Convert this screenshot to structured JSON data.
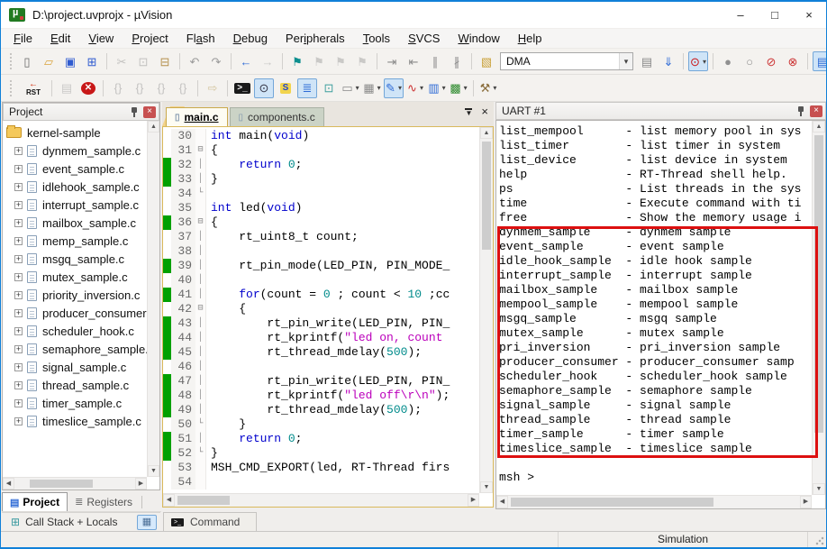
{
  "window": {
    "title": "D:\\project.uvprojx - µVision",
    "minimize": "–",
    "maximize": "□",
    "close": "×"
  },
  "icons": {
    "up": "▲",
    "down": "▼",
    "left": "◀",
    "right": "▶"
  },
  "menu": {
    "items": [
      {
        "label": "File",
        "accel": 0
      },
      {
        "label": "Edit",
        "accel": 0
      },
      {
        "label": "View",
        "accel": 0
      },
      {
        "label": "Project",
        "accel": 0
      },
      {
        "label": "Flash",
        "accel": 2
      },
      {
        "label": "Debug",
        "accel": 0
      },
      {
        "label": "Peripherals",
        "accel": 3
      },
      {
        "label": "Tools",
        "accel": 0
      },
      {
        "label": "SVCS",
        "accel": 0
      },
      {
        "label": "Window",
        "accel": 0
      },
      {
        "label": "Help",
        "accel": 0
      }
    ]
  },
  "toolbar_main": {
    "buttons": [
      {
        "name": "new-file-button",
        "g": "▯",
        "c": "#666"
      },
      {
        "name": "open-file-button",
        "g": "▱",
        "c": "#d9a43d"
      },
      {
        "name": "save-button",
        "g": "▣",
        "c": "#2f5bd0"
      },
      {
        "name": "save-all-button",
        "g": "⊞",
        "c": "#2f5bd0"
      },
      {
        "sep": true
      },
      {
        "name": "cut-button",
        "g": "✂",
        "c": "#999",
        "off": true
      },
      {
        "name": "copy-button",
        "g": "⊡",
        "c": "#999",
        "off": true
      },
      {
        "name": "paste-button",
        "g": "⊟",
        "c": "#b5914e"
      },
      {
        "sep": true
      },
      {
        "name": "undo-button",
        "g": "↶",
        "c": "#9a9a9a"
      },
      {
        "name": "redo-button",
        "g": "↷",
        "c": "#9a9a9a"
      },
      {
        "sep": true
      },
      {
        "name": "navigate-back-button",
        "g": "←",
        "c": "#2e6bd6"
      },
      {
        "name": "navigate-forward-button",
        "g": "→",
        "c": "#a8a8a8",
        "off": true
      },
      {
        "sep": true
      },
      {
        "name": "insert-bookmark-button",
        "g": "⚑",
        "c": "#0d8f8f"
      },
      {
        "name": "previous-bookmark-button",
        "g": "⚑",
        "c": "#a8a8a8",
        "off": true
      },
      {
        "name": "next-bookmark-button",
        "g": "⚑",
        "c": "#a8a8a8",
        "off": true
      },
      {
        "name": "clear-bookmarks-button",
        "g": "⚑",
        "c": "#a8a8a8",
        "off": true
      },
      {
        "sep": true
      },
      {
        "name": "indent-button",
        "g": "⇥",
        "c": "#8a8a8a"
      },
      {
        "name": "unindent-button",
        "g": "⇤",
        "c": "#8a8a8a"
      },
      {
        "name": "comment-button",
        "g": "∥",
        "c": "#8a8a8a"
      },
      {
        "name": "uncomment-button",
        "g": "∦",
        "c": "#8a8a8a"
      },
      {
        "sep": true
      },
      {
        "name": "options-for-target-button",
        "g": "▧",
        "c": "#caa23a"
      },
      {
        "name": "target-select",
        "combo": true,
        "value": "DMA"
      },
      {
        "name": "file-extensions-button",
        "g": "▤",
        "c": "#8a8a8a"
      },
      {
        "name": "find-in-files-button",
        "g": "⇓",
        "c": "#2e6bd6"
      },
      {
        "sep": true
      },
      {
        "name": "quick-search-dropdown",
        "g": "⊙",
        "c": "#cc1111",
        "dd": true,
        "on": true
      },
      {
        "sep": true
      },
      {
        "name": "insert-breakpoint-button",
        "g": "●",
        "c": "#909090"
      },
      {
        "name": "enable-breakpoint-button",
        "g": "○",
        "c": "#909090"
      },
      {
        "name": "disable-all-breakpoints-button",
        "g": "⊘",
        "c": "#cc3333"
      },
      {
        "name": "kill-all-breakpoints-button",
        "g": "⊗",
        "c": "#cc3333"
      },
      {
        "sep": true
      },
      {
        "name": "project-window-toggle",
        "g": "▤",
        "c": "#2e6bd6",
        "on": true
      }
    ]
  },
  "toolbar_debug": {
    "buttons": [
      {
        "name": "reset-button",
        "g": "←",
        "c": "#cc2200",
        "g2": "RST"
      },
      {
        "sep": true
      },
      {
        "name": "show-next-statement-button",
        "g": "▤",
        "c": "#a8a8a8",
        "off": true
      },
      {
        "name": "stop-button",
        "g": "✕",
        "c": "#fff",
        "bg": "#c81818",
        "round": true
      },
      {
        "sep": true
      },
      {
        "name": "step-button",
        "g": "{}",
        "c": "#9a9a9a",
        "off": true
      },
      {
        "name": "step-over-button",
        "g": "{}",
        "c": "#9a9a9a",
        "off": true
      },
      {
        "name": "step-out-button",
        "g": "{}",
        "c": "#9a9a9a",
        "off": true
      },
      {
        "name": "run-to-cursor-button",
        "g": "{}",
        "c": "#9a9a9a",
        "off": true
      },
      {
        "sep": true
      },
      {
        "name": "run-button",
        "g": "⇨",
        "c": "#b9a15e",
        "off": true
      },
      {
        "sep": true
      },
      {
        "name": "command-window-button",
        "g": ">_",
        "c": "#fff",
        "bg": "#1a1a1a"
      },
      {
        "name": "disassembly-window-button",
        "g": "⊙",
        "c": "#334",
        "on": true
      },
      {
        "name": "symbol-window-button",
        "g": "S",
        "c": "#2244cc",
        "bg": "#f2d44c"
      },
      {
        "name": "registers-window-button",
        "g": "≣",
        "c": "#2e6bd6",
        "on": true
      },
      {
        "name": "callstack-window-button",
        "g": "⊡",
        "c": "#3f9f9f"
      },
      {
        "name": "watch-windows-dropdown",
        "g": "▭",
        "c": "#8a8a8a",
        "dd": true
      },
      {
        "name": "memory-windows-dropdown",
        "g": "▦",
        "c": "#8a8a8a",
        "dd": true
      },
      {
        "name": "serial-windows-dropdown",
        "g": "✎",
        "c": "#2e6bd6",
        "dd": true,
        "on": true
      },
      {
        "name": "analysis-windows-dropdown",
        "g": "∿",
        "c": "#cc3333",
        "dd": true
      },
      {
        "name": "trace-windows-dropdown",
        "g": "▥",
        "c": "#2e6bd6",
        "dd": true
      },
      {
        "name": "system-viewer-dropdown",
        "g": "▩",
        "c": "#2e8b2e",
        "dd": true
      },
      {
        "sep": true
      },
      {
        "name": "toolbox-dropdown",
        "g": "⚒",
        "c": "#8a6d3b",
        "dd": true
      }
    ]
  },
  "project": {
    "title": "Project",
    "root": "kernel-sample",
    "files": [
      "dynmem_sample.c",
      "event_sample.c",
      "idlehook_sample.c",
      "interrupt_sample.c",
      "mailbox_sample.c",
      "memp_sample.c",
      "msgq_sample.c",
      "mutex_sample.c",
      "priority_inversion.c",
      "producer_consumer.c",
      "scheduler_hook.c",
      "semaphore_sample.c",
      "signal_sample.c",
      "thread_sample.c",
      "timer_sample.c",
      "timeslice_sample.c"
    ],
    "tabs": [
      {
        "label": "Project",
        "active": true
      },
      {
        "label": "Registers",
        "active": false
      }
    ]
  },
  "callstack_bar": {
    "label": "Call Stack + Locals"
  },
  "command_tab": {
    "label": "Command"
  },
  "editor": {
    "tabs": [
      {
        "label": "main.c",
        "active": true
      },
      {
        "label": "components.c",
        "active": false
      }
    ],
    "lines": [
      {
        "n": 30,
        "t": "int main(void)",
        "m": false,
        "f": ""
      },
      {
        "n": 31,
        "t": "{",
        "m": false,
        "f": "open"
      },
      {
        "n": 32,
        "t": "    return 0;",
        "m": true,
        "f": "line"
      },
      {
        "n": 33,
        "t": "}",
        "m": true,
        "f": "line"
      },
      {
        "n": 34,
        "t": "",
        "m": false,
        "f": "end"
      },
      {
        "n": 35,
        "t": "int led(void)",
        "m": false,
        "f": ""
      },
      {
        "n": 36,
        "t": "{",
        "m": true,
        "f": "open"
      },
      {
        "n": 37,
        "t": "    rt_uint8_t count;",
        "m": false,
        "f": "line"
      },
      {
        "n": 38,
        "t": "",
        "m": false,
        "f": "line"
      },
      {
        "n": 39,
        "t": "    rt_pin_mode(LED_PIN, PIN_MODE_",
        "m": true,
        "f": "line"
      },
      {
        "n": 40,
        "t": "",
        "m": false,
        "f": "line"
      },
      {
        "n": 41,
        "t": "    for(count = 0 ; count < 10 ;cc",
        "m": true,
        "f": "line"
      },
      {
        "n": 42,
        "t": "    {",
        "m": false,
        "f": "open"
      },
      {
        "n": 43,
        "t": "        rt_pin_write(LED_PIN, PIN_",
        "m": true,
        "f": "line"
      },
      {
        "n": 44,
        "t": "        rt_kprintf(\"led on, count",
        "m": true,
        "f": "line"
      },
      {
        "n": 45,
        "t": "        rt_thread_mdelay(500);",
        "m": true,
        "f": "line"
      },
      {
        "n": 46,
        "t": "",
        "m": false,
        "f": "line"
      },
      {
        "n": 47,
        "t": "        rt_pin_write(LED_PIN, PIN_",
        "m": true,
        "f": "line"
      },
      {
        "n": 48,
        "t": "        rt_kprintf(\"led off\\r\\n\");",
        "m": true,
        "f": "line"
      },
      {
        "n": 49,
        "t": "        rt_thread_mdelay(500);",
        "m": true,
        "f": "line"
      },
      {
        "n": 50,
        "t": "    }",
        "m": false,
        "f": "end"
      },
      {
        "n": 51,
        "t": "    return 0;",
        "m": true,
        "f": "line"
      },
      {
        "n": 52,
        "t": "}",
        "m": true,
        "f": "end"
      },
      {
        "n": 53,
        "t": "MSH_CMD_EXPORT(led, RT-Thread firs",
        "m": false,
        "f": ""
      },
      {
        "n": 54,
        "t": "",
        "m": false,
        "f": ""
      }
    ]
  },
  "uart": {
    "title": "UART #1",
    "lines": [
      "list_mempool      - list memory pool in sys",
      "list_timer        - list timer in system",
      "list_device       - list device in system",
      "help              - RT-Thread shell help.",
      "ps                - List threads in the sys",
      "time              - Execute command with ti",
      "free              - Show the memory usage i",
      "dynmem_sample     - dynmem sample",
      "event_sample      - event sample",
      "idle_hook_sample  - idle hook sample",
      "interrupt_sample  - interrupt sample",
      "mailbox_sample    - mailbox sample",
      "mempool_sample    - mempool sample",
      "msgq_sample       - msgq sample",
      "mutex_sample      - mutex sample",
      "pri_inversion     - pri_inversion sample",
      "producer_consumer - producer_consumer samp",
      "scheduler_hook    - scheduler_hook sample",
      "semaphore_sample  - semaphore sample",
      "signal_sample     - signal sample",
      "thread_sample     - thread sample",
      "timer_sample      - timer sample",
      "timeslice_sample  - timeslice sample",
      ""
    ],
    "prompt": "msh >"
  },
  "status": {
    "mode": "Simulation"
  },
  "highlight": {
    "keywords": [
      "int",
      "void",
      "return",
      "for"
    ],
    "colors": {
      "keyword": "#0000cc",
      "number": "#008b8b",
      "string": "#bb00bb",
      "modified_bar": "#00a000",
      "annotation_box": "#dd1010"
    }
  }
}
